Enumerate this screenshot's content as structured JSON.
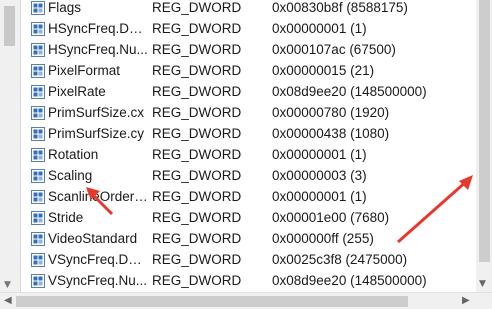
{
  "registry": {
    "rows": [
      {
        "name": "Flags",
        "type": "REG_DWORD",
        "data": "0x00830b8f (8588175)"
      },
      {
        "name": "HSyncFreq.Den...",
        "type": "REG_DWORD",
        "data": "0x00000001 (1)"
      },
      {
        "name": "HSyncFreq.Nu...",
        "type": "REG_DWORD",
        "data": "0x000107ac (67500)"
      },
      {
        "name": "PixelFormat",
        "type": "REG_DWORD",
        "data": "0x00000015 (21)"
      },
      {
        "name": "PixelRate",
        "type": "REG_DWORD",
        "data": "0x08d9ee20 (148500000)"
      },
      {
        "name": "PrimSurfSize.cx",
        "type": "REG_DWORD",
        "data": "0x00000780 (1920)"
      },
      {
        "name": "PrimSurfSize.cy",
        "type": "REG_DWORD",
        "data": "0x00000438 (1080)"
      },
      {
        "name": "Rotation",
        "type": "REG_DWORD",
        "data": "0x00000001 (1)"
      },
      {
        "name": "Scaling",
        "type": "REG_DWORD",
        "data": "0x00000003 (3)"
      },
      {
        "name": "ScanlineOrderi...",
        "type": "REG_DWORD",
        "data": "0x00000001 (1)"
      },
      {
        "name": "Stride",
        "type": "REG_DWORD",
        "data": "0x00001e00 (7680)"
      },
      {
        "name": "VideoStandard",
        "type": "REG_DWORD",
        "data": "0x000000ff (255)"
      },
      {
        "name": "VSyncFreq.Den...",
        "type": "REG_DWORD",
        "data": "0x0025c3f8 (2475000)"
      },
      {
        "name": "VSyncFreq.Nu...",
        "type": "REG_DWORD",
        "data": "0x08d9ee20 (148500000)"
      }
    ]
  },
  "icons": {
    "row_icon": "reg-dword-icon",
    "annotation": "red-arrow-icon"
  },
  "colors": {
    "annotation_red": "#e8382e",
    "icon_blue": "#2f6fc4"
  }
}
